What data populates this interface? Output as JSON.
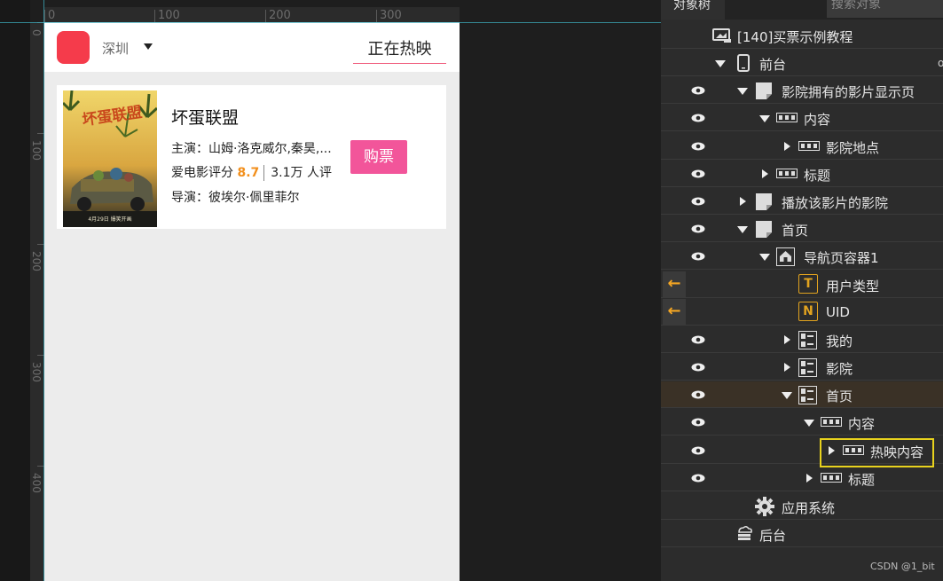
{
  "ruler": {
    "horizontal": [
      "0",
      "100",
      "200",
      "300"
    ],
    "vertical": [
      "0",
      "100",
      "200",
      "300",
      "400"
    ]
  },
  "phone": {
    "city": "深圳",
    "tab_label": "正在热映",
    "movie": {
      "title": "坏蛋联盟",
      "cast_label": "主演：",
      "cast": "山姆·洛克威尔,秦昊,...",
      "score_label": "爱电影评分",
      "score": "8.7",
      "raters": "3.1万 人评",
      "director_label": "导演：",
      "director": "彼埃尔·佩里菲尔",
      "buy_label": "购票",
      "poster_title": "坏蛋联盟",
      "poster_date": "4月29日 爆笑开画"
    }
  },
  "panel": {
    "tab_title": "对象树",
    "search_placeholder": "搜索对象",
    "watermark": "CSDN @1_bit",
    "tree": [
      {
        "label": "[140]买票示例教程",
        "icon": "project-icon"
      },
      {
        "label": "前台",
        "icon": "phone-icon"
      },
      {
        "label": "影院拥有的影片显示页",
        "icon": "page-icon"
      },
      {
        "label": "内容",
        "icon": "container-icon"
      },
      {
        "label": "影院地点",
        "icon": "container-icon"
      },
      {
        "label": "标题",
        "icon": "container-icon"
      },
      {
        "label": "播放该影片的影院",
        "icon": "page-icon"
      },
      {
        "label": "首页",
        "icon": "page-icon"
      },
      {
        "label": "导航页容器1",
        "icon": "home-icon"
      },
      {
        "label": "用户类型",
        "icon": "text-variable-icon",
        "badge": "T"
      },
      {
        "label": "UID",
        "icon": "number-variable-icon",
        "badge": "N"
      },
      {
        "label": "我的",
        "icon": "nav-page-icon"
      },
      {
        "label": "影院",
        "icon": "nav-page-icon"
      },
      {
        "label": "首页",
        "icon": "nav-page-icon"
      },
      {
        "label": "内容",
        "icon": "container-icon"
      },
      {
        "label": "热映内容",
        "icon": "container-icon"
      },
      {
        "label": "标题",
        "icon": "container-icon"
      },
      {
        "label": "应用系统",
        "icon": "gear-icon"
      },
      {
        "label": "后台",
        "icon": "cloud-server-icon"
      }
    ]
  },
  "colors": {
    "accent_red": "#f53b4b",
    "buy_pink": "#f2559a",
    "score_orange": "#f28f1c",
    "highlight_yellow": "#e8d21d",
    "variable_orange": "#e2a31f"
  }
}
